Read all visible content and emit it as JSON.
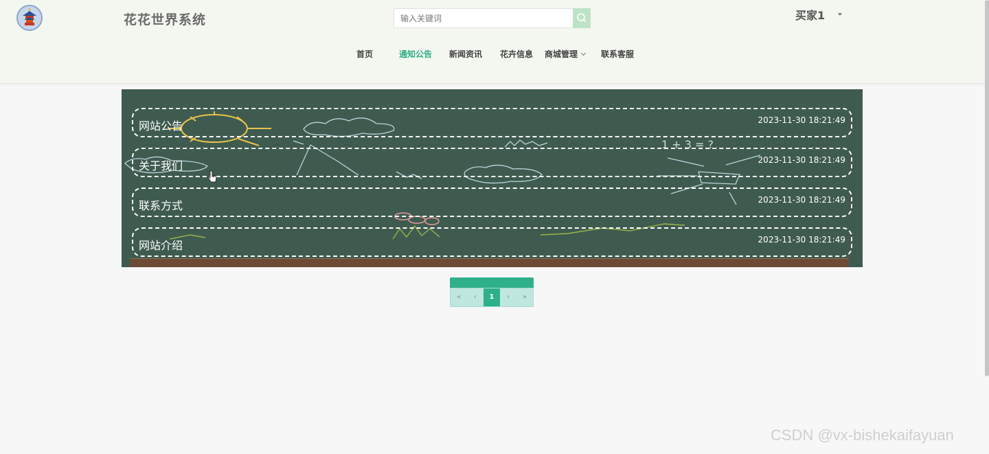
{
  "header": {
    "site_title": "花花世界系统",
    "search": {
      "placeholder": "输入关键词",
      "value": ""
    },
    "user": {
      "name": "买家1"
    }
  },
  "nav": {
    "items": [
      {
        "label": "首页",
        "active": false
      },
      {
        "label": "通知公告",
        "active": true
      },
      {
        "label": "新闻资讯",
        "active": false
      },
      {
        "label": "花卉信息",
        "active": false
      },
      {
        "label": "商城管理",
        "active": false,
        "has_dropdown": true
      },
      {
        "label": "联系客服",
        "active": false
      }
    ]
  },
  "notices": [
    {
      "title": "网站公告",
      "date": "2023-11-30 18:21:49"
    },
    {
      "title": "关于我们",
      "date": "2023-11-30 18:21:49"
    },
    {
      "title": "联系方式",
      "date": "2023-11-30 18:21:49"
    },
    {
      "title": "网站介绍",
      "date": "2023-11-30 18:21:49"
    }
  ],
  "pagination": {
    "first": "«",
    "prev": "‹",
    "current": "1",
    "next": "›",
    "last": "»"
  },
  "watermark": "CSDN @vx-bishekaifayuan",
  "colors": {
    "accent": "#2eb088",
    "header_bg": "#f3f7ef",
    "board_bg": "#3f5b50"
  }
}
